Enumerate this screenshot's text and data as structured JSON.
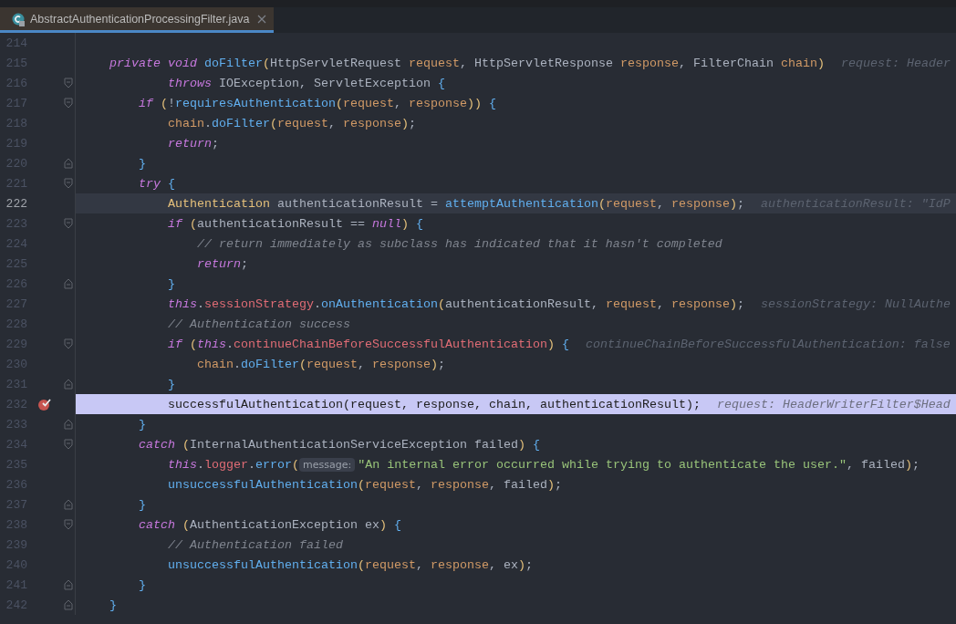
{
  "tab": {
    "title": "AbstractAuthenticationProcessingFilter.java",
    "selected": true
  },
  "lines": [
    {
      "number": "214",
      "execution_point": false,
      "caret": false,
      "breakpoint": false,
      "fold_start": false,
      "fold_end": false
    },
    {
      "number": "215",
      "execution_point": false,
      "caret": false,
      "breakpoint": false,
      "fold_start": false,
      "fold_end": false,
      "tokens": [
        {
          "kind": "keyword",
          "text": "    private void "
        },
        {
          "kind": "function",
          "text": "doFilter"
        },
        {
          "kind": "paren",
          "text": "("
        },
        {
          "kind": "plain",
          "text": "HttpServletRequest "
        },
        {
          "kind": "param",
          "text": "request"
        },
        {
          "kind": "plain",
          "text": ", HttpServletResponse "
        },
        {
          "kind": "param",
          "text": "response"
        },
        {
          "kind": "plain",
          "text": ", FilterChain "
        },
        {
          "kind": "param",
          "text": "chain"
        },
        {
          "kind": "paren",
          "text": ")"
        }
      ],
      "hint": "request: Header"
    },
    {
      "number": "216",
      "execution_point": false,
      "caret": false,
      "breakpoint": false,
      "fold_start": true,
      "fold_end": false,
      "tokens": [
        {
          "kind": "keyword",
          "text": "            throws "
        },
        {
          "kind": "plain",
          "text": "IOException, ServletException"
        },
        {
          "kind": "brace",
          "text": " {"
        }
      ]
    },
    {
      "number": "217",
      "execution_point": false,
      "caret": false,
      "breakpoint": false,
      "fold_start": true,
      "fold_end": false,
      "tokens": [
        {
          "kind": "keyword",
          "text": "        if "
        },
        {
          "kind": "paren",
          "text": "("
        },
        {
          "kind": "plain",
          "text": "!"
        },
        {
          "kind": "function",
          "text": "requiresAuthentication"
        },
        {
          "kind": "paren",
          "text": "("
        },
        {
          "kind": "param",
          "text": "request"
        },
        {
          "kind": "plain",
          "text": ", "
        },
        {
          "kind": "param",
          "text": "response"
        },
        {
          "kind": "paren",
          "text": "))"
        },
        {
          "kind": "brace",
          "text": " {"
        }
      ]
    },
    {
      "number": "218",
      "execution_point": false,
      "caret": false,
      "breakpoint": false,
      "fold_start": false,
      "fold_end": false,
      "tokens": [
        {
          "kind": "param",
          "text": "            chain"
        },
        {
          "kind": "plain",
          "text": "."
        },
        {
          "kind": "function",
          "text": "doFilter"
        },
        {
          "kind": "paren",
          "text": "("
        },
        {
          "kind": "param",
          "text": "request"
        },
        {
          "kind": "plain",
          "text": ", "
        },
        {
          "kind": "param",
          "text": "response"
        },
        {
          "kind": "paren",
          "text": ")"
        },
        {
          "kind": "plain",
          "text": ";"
        }
      ]
    },
    {
      "number": "219",
      "execution_point": false,
      "caret": false,
      "breakpoint": false,
      "fold_start": false,
      "fold_end": false,
      "tokens": [
        {
          "kind": "keyword",
          "text": "            return"
        },
        {
          "kind": "plain",
          "text": ";"
        }
      ]
    },
    {
      "number": "220",
      "execution_point": false,
      "caret": false,
      "breakpoint": false,
      "fold_start": false,
      "fold_end": true,
      "tokens": [
        {
          "kind": "brace",
          "text": "        }"
        }
      ]
    },
    {
      "number": "221",
      "execution_point": false,
      "caret": false,
      "breakpoint": false,
      "fold_start": true,
      "fold_end": false,
      "tokens": [
        {
          "kind": "keyword",
          "text": "        try"
        },
        {
          "kind": "brace",
          "text": " {"
        }
      ]
    },
    {
      "number": "222",
      "execution_point": false,
      "caret": true,
      "breakpoint": false,
      "fold_start": false,
      "fold_end": false,
      "tokens": [
        {
          "kind": "type",
          "text": "            Authentication"
        },
        {
          "kind": "plain",
          "text": " authenticationResult = "
        },
        {
          "kind": "function",
          "text": "attemptAuthentication"
        },
        {
          "kind": "paren",
          "text": "("
        },
        {
          "kind": "param",
          "text": "request"
        },
        {
          "kind": "plain",
          "text": ", "
        },
        {
          "kind": "param",
          "text": "response"
        },
        {
          "kind": "paren",
          "text": ")"
        },
        {
          "kind": "plain",
          "text": ";"
        }
      ],
      "hint": "authenticationResult: \"IdP"
    },
    {
      "number": "223",
      "execution_point": false,
      "caret": false,
      "breakpoint": false,
      "fold_start": true,
      "fold_end": false,
      "tokens": [
        {
          "kind": "keyword",
          "text": "            if "
        },
        {
          "kind": "paren",
          "text": "("
        },
        {
          "kind": "plain",
          "text": "authenticationResult == "
        },
        {
          "kind": "keyword",
          "text": "null"
        },
        {
          "kind": "paren",
          "text": ")"
        },
        {
          "kind": "brace",
          "text": " {"
        }
      ]
    },
    {
      "number": "224",
      "execution_point": false,
      "caret": false,
      "breakpoint": false,
      "fold_start": false,
      "fold_end": false,
      "tokens": [
        {
          "kind": "comment",
          "text": "                // return immediately as subclass has indicated that it hasn't completed"
        }
      ]
    },
    {
      "number": "225",
      "execution_point": false,
      "caret": false,
      "breakpoint": false,
      "fold_start": false,
      "fold_end": false,
      "tokens": [
        {
          "kind": "keyword",
          "text": "                return"
        },
        {
          "kind": "plain",
          "text": ";"
        }
      ]
    },
    {
      "number": "226",
      "execution_point": false,
      "caret": false,
      "breakpoint": false,
      "fold_start": false,
      "fold_end": true,
      "tokens": [
        {
          "kind": "brace",
          "text": "            }"
        }
      ]
    },
    {
      "number": "227",
      "execution_point": false,
      "caret": false,
      "breakpoint": false,
      "fold_start": false,
      "fold_end": false,
      "tokens": [
        {
          "kind": "keyword",
          "text": "            this"
        },
        {
          "kind": "plain",
          "text": "."
        },
        {
          "kind": "field",
          "text": "sessionStrategy"
        },
        {
          "kind": "plain",
          "text": "."
        },
        {
          "kind": "function",
          "text": "onAuthentication"
        },
        {
          "kind": "paren",
          "text": "("
        },
        {
          "kind": "plain",
          "text": "authenticationResult, "
        },
        {
          "kind": "param",
          "text": "request"
        },
        {
          "kind": "plain",
          "text": ", "
        },
        {
          "kind": "param",
          "text": "response"
        },
        {
          "kind": "paren",
          "text": ")"
        },
        {
          "kind": "plain",
          "text": ";"
        }
      ],
      "hint": "sessionStrategy: NullAuthe"
    },
    {
      "number": "228",
      "execution_point": false,
      "caret": false,
      "breakpoint": false,
      "fold_start": false,
      "fold_end": false,
      "tokens": [
        {
          "kind": "comment",
          "text": "            // Authentication success"
        }
      ]
    },
    {
      "number": "229",
      "execution_point": false,
      "caret": false,
      "breakpoint": false,
      "fold_start": true,
      "fold_end": false,
      "tokens": [
        {
          "kind": "keyword",
          "text": "            if "
        },
        {
          "kind": "paren",
          "text": "("
        },
        {
          "kind": "keyword",
          "text": "this"
        },
        {
          "kind": "plain",
          "text": "."
        },
        {
          "kind": "field",
          "text": "continueChainBeforeSuccessfulAuthentication"
        },
        {
          "kind": "paren",
          "text": ")"
        },
        {
          "kind": "brace",
          "text": " {"
        }
      ],
      "hint": "continueChainBeforeSuccessfulAuthentication: false"
    },
    {
      "number": "230",
      "execution_point": false,
      "caret": false,
      "breakpoint": false,
      "fold_start": false,
      "fold_end": false,
      "tokens": [
        {
          "kind": "param",
          "text": "                chain"
        },
        {
          "kind": "plain",
          "text": "."
        },
        {
          "kind": "function",
          "text": "doFilter"
        },
        {
          "kind": "paren",
          "text": "("
        },
        {
          "kind": "param",
          "text": "request"
        },
        {
          "kind": "plain",
          "text": ", "
        },
        {
          "kind": "param",
          "text": "response"
        },
        {
          "kind": "paren",
          "text": ")"
        },
        {
          "kind": "plain",
          "text": ";"
        }
      ]
    },
    {
      "number": "231",
      "execution_point": false,
      "caret": false,
      "breakpoint": false,
      "fold_start": false,
      "fold_end": true,
      "tokens": [
        {
          "kind": "brace",
          "text": "            }"
        }
      ]
    },
    {
      "number": "232",
      "execution_point": true,
      "caret": false,
      "breakpoint": true,
      "fold_start": false,
      "fold_end": false,
      "tokens": [
        {
          "kind": "function",
          "text": "            successfulAuthentication"
        },
        {
          "kind": "paren",
          "text": "("
        },
        {
          "kind": "param",
          "text": "request"
        },
        {
          "kind": "plain",
          "text": ", "
        },
        {
          "kind": "param",
          "text": "response"
        },
        {
          "kind": "plain",
          "text": ", "
        },
        {
          "kind": "param",
          "text": "chain"
        },
        {
          "kind": "plain",
          "text": ", authenticationResult"
        },
        {
          "kind": "paren",
          "text": ")"
        },
        {
          "kind": "plain",
          "text": ";"
        }
      ],
      "hint": "request: HeaderWriterFilter$Head"
    },
    {
      "number": "233",
      "execution_point": false,
      "caret": false,
      "breakpoint": false,
      "fold_start": false,
      "fold_end": true,
      "tokens": [
        {
          "kind": "brace",
          "text": "        }"
        }
      ]
    },
    {
      "number": "234",
      "execution_point": false,
      "caret": false,
      "breakpoint": false,
      "fold_start": true,
      "fold_end": false,
      "tokens": [
        {
          "kind": "keyword",
          "text": "        catch "
        },
        {
          "kind": "paren",
          "text": "("
        },
        {
          "kind": "plain",
          "text": "InternalAuthenticationServiceException failed"
        },
        {
          "kind": "paren",
          "text": ")"
        },
        {
          "kind": "brace",
          "text": " {"
        }
      ]
    },
    {
      "number": "235",
      "execution_point": false,
      "caret": false,
      "breakpoint": false,
      "fold_start": false,
      "fold_end": false,
      "tokens": [
        {
          "kind": "keyword",
          "text": "            this"
        },
        {
          "kind": "plain",
          "text": "."
        },
        {
          "kind": "field",
          "text": "logger"
        },
        {
          "kind": "plain",
          "text": "."
        },
        {
          "kind": "function",
          "text": "error"
        },
        {
          "kind": "paren",
          "text": "("
        },
        {
          "kind": "inlay",
          "text": "message:"
        },
        {
          "kind": "string",
          "text": "\"An internal error occurred while trying to authenticate the user.\""
        },
        {
          "kind": "plain",
          "text": ", failed"
        },
        {
          "kind": "paren",
          "text": ")"
        },
        {
          "kind": "plain",
          "text": ";"
        }
      ]
    },
    {
      "number": "236",
      "execution_point": false,
      "caret": false,
      "breakpoint": false,
      "fold_start": false,
      "fold_end": false,
      "tokens": [
        {
          "kind": "function",
          "text": "            unsuccessfulAuthentication"
        },
        {
          "kind": "paren",
          "text": "("
        },
        {
          "kind": "param",
          "text": "request"
        },
        {
          "kind": "plain",
          "text": ", "
        },
        {
          "kind": "param",
          "text": "response"
        },
        {
          "kind": "plain",
          "text": ", failed"
        },
        {
          "kind": "paren",
          "text": ")"
        },
        {
          "kind": "plain",
          "text": ";"
        }
      ]
    },
    {
      "number": "237",
      "execution_point": false,
      "caret": false,
      "breakpoint": false,
      "fold_start": false,
      "fold_end": true,
      "tokens": [
        {
          "kind": "brace",
          "text": "        }"
        }
      ]
    },
    {
      "number": "238",
      "execution_point": false,
      "caret": false,
      "breakpoint": false,
      "fold_start": true,
      "fold_end": false,
      "tokens": [
        {
          "kind": "keyword",
          "text": "        catch "
        },
        {
          "kind": "paren",
          "text": "("
        },
        {
          "kind": "plain",
          "text": "AuthenticationException ex"
        },
        {
          "kind": "paren",
          "text": ")"
        },
        {
          "kind": "brace",
          "text": " {"
        }
      ]
    },
    {
      "number": "239",
      "execution_point": false,
      "caret": false,
      "breakpoint": false,
      "fold_start": false,
      "fold_end": false,
      "tokens": [
        {
          "kind": "comment",
          "text": "            // Authentication failed"
        }
      ]
    },
    {
      "number": "240",
      "execution_point": false,
      "caret": false,
      "breakpoint": false,
      "fold_start": false,
      "fold_end": false,
      "tokens": [
        {
          "kind": "function",
          "text": "            unsuccessfulAuthentication"
        },
        {
          "kind": "paren",
          "text": "("
        },
        {
          "kind": "param",
          "text": "request"
        },
        {
          "kind": "plain",
          "text": ", "
        },
        {
          "kind": "param",
          "text": "response"
        },
        {
          "kind": "plain",
          "text": ", ex"
        },
        {
          "kind": "paren",
          "text": ")"
        },
        {
          "kind": "plain",
          "text": ";"
        }
      ]
    },
    {
      "number": "241",
      "execution_point": false,
      "caret": false,
      "breakpoint": false,
      "fold_start": false,
      "fold_end": true,
      "tokens": [
        {
          "kind": "brace",
          "text": "        }"
        }
      ]
    },
    {
      "number": "242",
      "execution_point": false,
      "caret": false,
      "breakpoint": false,
      "fold_start": false,
      "fold_end": true,
      "tokens": [
        {
          "kind": "brace",
          "text": "    }"
        }
      ]
    }
  ]
}
